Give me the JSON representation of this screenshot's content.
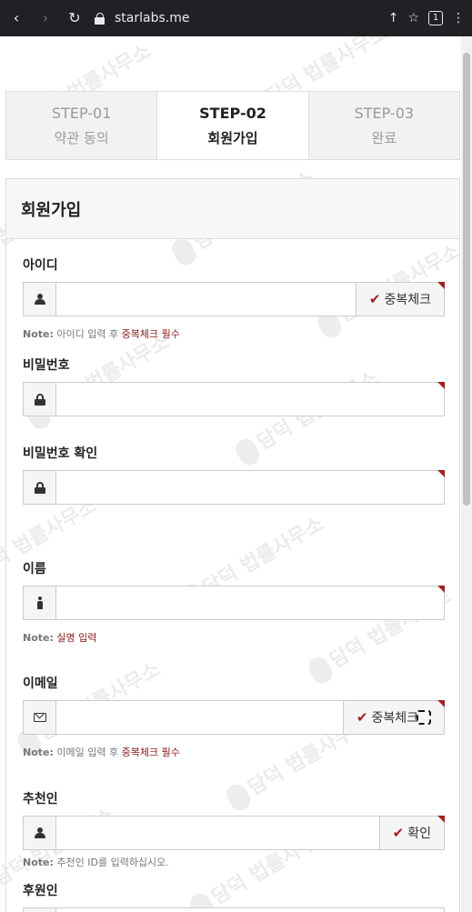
{
  "browser": {
    "url": "starlabs.me",
    "tab_count": "1",
    "icons": [
      "back-icon",
      "forward-icon",
      "reload-icon",
      "site-settings-icon",
      "share-icon",
      "bookmark-icon",
      "tab-switcher-icon",
      "more-icon"
    ]
  },
  "watermark": {
    "text": "담덕 법률사무소"
  },
  "steps": [
    {
      "number": "STEP-01",
      "label": "약관 동의",
      "active": false
    },
    {
      "number": "STEP-02",
      "label": "회원가입",
      "active": true
    },
    {
      "number": "STEP-03",
      "label": "완료",
      "active": false
    }
  ],
  "form": {
    "title": "회원가입",
    "id": {
      "label": "아이디",
      "button": "중복체크",
      "note_prefix": "Note:",
      "note_text": " 아이디 입력 후 ",
      "note_highlight": "중복체크 필수"
    },
    "password": {
      "label": "비밀번호"
    },
    "password_confirm": {
      "label": "비밀번호 확인"
    },
    "name": {
      "label": "이름",
      "note_prefix": "Note:",
      "note_highlight": "실명 입력"
    },
    "email": {
      "label": "이메일",
      "button": "중복체크",
      "note_prefix": "Note:",
      "note_text": " 이메일 입력 후 ",
      "note_highlight": "중복체크 필수"
    },
    "recommender": {
      "label": "추천인",
      "button": "확인",
      "note_prefix": "Note:",
      "note_text": " 추천인 ID를 입력하십시오."
    },
    "sponsor": {
      "label": "후원인"
    }
  },
  "colors": {
    "accent": "#a31f1f",
    "note_red": "#8b1a1a",
    "browser_bar": "#202124"
  }
}
